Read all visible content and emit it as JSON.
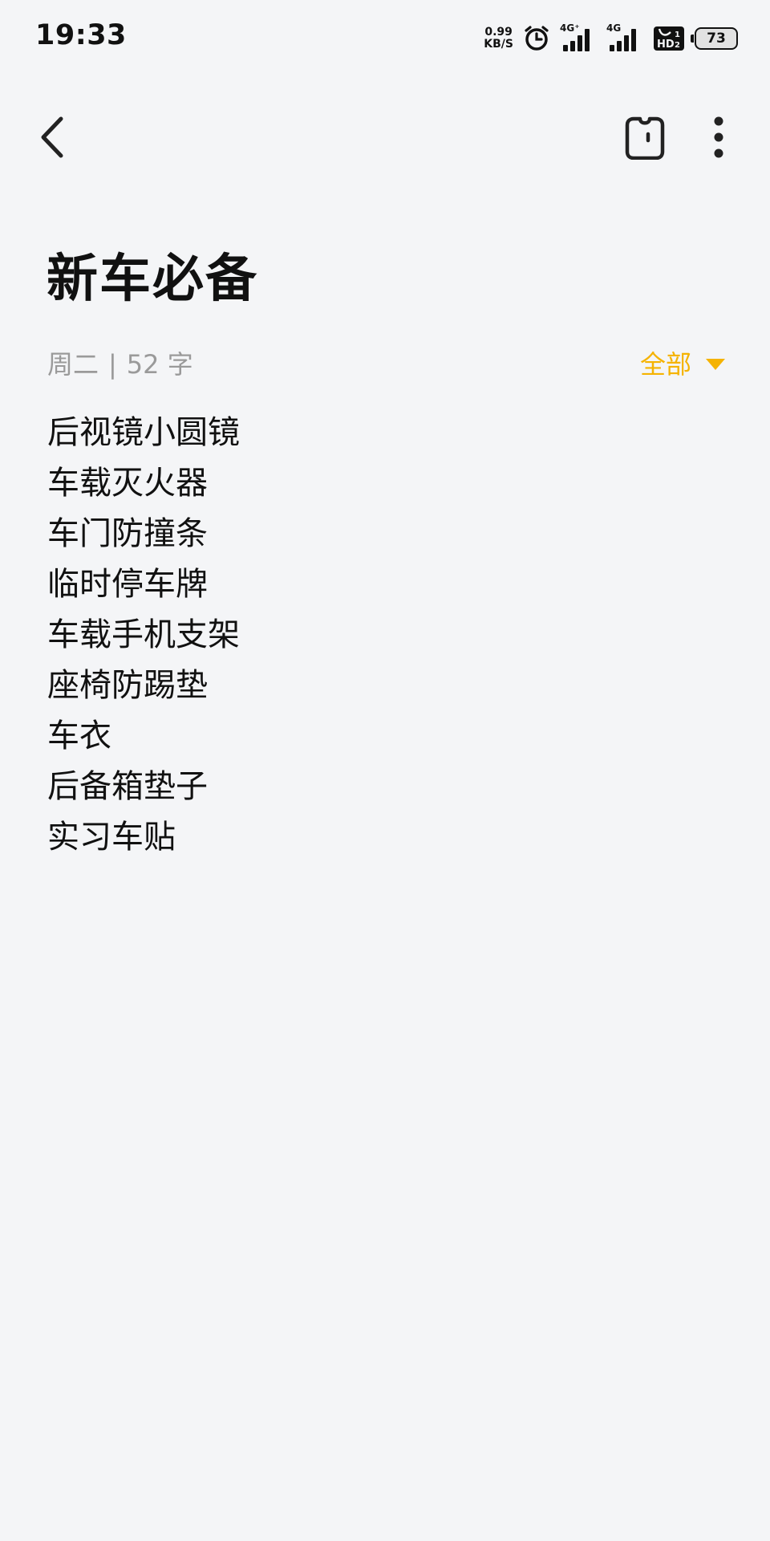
{
  "status_bar": {
    "time": "19:33",
    "net_speed_value": "0.99",
    "net_speed_unit": "KB/S",
    "alarm_icon": "alarm-clock-icon",
    "signal1_label": "4G⁺",
    "signal2_label": "4G",
    "hd_icon": "hd-voice-icon",
    "battery_level": "73"
  },
  "toolbar": {
    "back_icon": "chevron-left-icon",
    "share_icon": "share-bag-icon",
    "more_icon": "more-vertical-icon"
  },
  "note": {
    "title": "新车必备",
    "day": "周二",
    "separator": "|",
    "word_count": "52 字",
    "filter_label": "全部",
    "lines": [
      "后视镜小圆镜",
      "车载灭火器",
      "车门防撞条",
      "临时停车牌",
      "车载手机支架",
      "座椅防踢垫",
      "车衣",
      "后备箱垫子",
      "实习车贴"
    ]
  },
  "colors": {
    "background": "#f4f5f7",
    "accent": "#f5b301",
    "text": "#111111",
    "muted": "#9a9a9a"
  }
}
